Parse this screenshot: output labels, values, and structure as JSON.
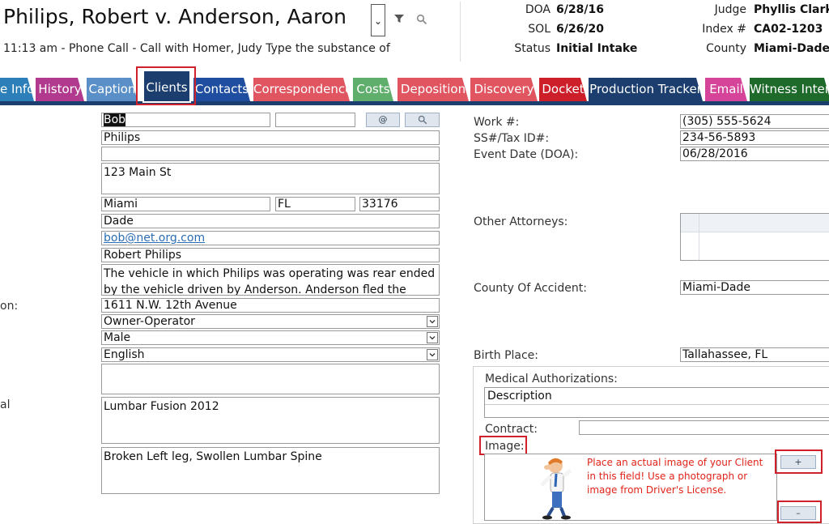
{
  "header": {
    "case_title": "Philips, Robert v. Anderson, Aaron",
    "last_activity": "11:13 am - Phone Call - Call with Homer, Judy  Type the substance of",
    "doa_label": "DOA",
    "doa_value": "6/28/16",
    "sol_label": "SOL",
    "sol_value": "6/26/20",
    "status_label": "Status",
    "status_value": "Initial Intake",
    "judge_label": "Judge",
    "judge_value": "Phyllis Clark",
    "index_label": "Index #",
    "index_value": "CA02-1203",
    "county_label": "County",
    "county_value": "Miami-Dade"
  },
  "tabs": [
    {
      "label": "e Info",
      "color": "#2c7fb8"
    },
    {
      "label": "History",
      "color": "#b23a8e"
    },
    {
      "label": "Caption",
      "color": "#5b8fc7"
    },
    {
      "label": "Clients",
      "color": "#1b3e6e",
      "active": true
    },
    {
      "label": "Contacts",
      "color": "#1f4ea1"
    },
    {
      "label": "Correspondence",
      "color": "#e05560"
    },
    {
      "label": "Costs",
      "color": "#5fae6b"
    },
    {
      "label": "Deposition",
      "color": "#e05560"
    },
    {
      "label": "Discovery",
      "color": "#e05560"
    },
    {
      "label": "Docket",
      "color": "#cc1f2a"
    },
    {
      "label": "Production Tracker",
      "color": "#1b3e6e"
    },
    {
      "label": "Email",
      "color": "#d6449a"
    },
    {
      "label": "Witness Interv",
      "color": "#1e6a2a"
    }
  ],
  "left_labels": {
    "on": "on:",
    "al": "al"
  },
  "form": {
    "first_name": "Bob",
    "middle_name": "",
    "at_button": "@",
    "search_button_icon": "search-icon",
    "last_name": "Philips",
    "suffix": "",
    "address": "123 Main St",
    "city": "Miami",
    "state": "FL",
    "zip": "33176",
    "county": "Dade",
    "email": "bob@net.org.com",
    "full_name": "Robert Philips",
    "description": "The vehicle in which Philips was operating was rear ended by the vehicle driven by Anderson.  Anderson fled the",
    "accident_location": "1611 N.W. 12th Avenue",
    "occupation": "Owner-Operator",
    "gender": "Male",
    "language": "English",
    "notes": "",
    "medical_history": "Lumbar Fusion 2012",
    "injuries": "Broken Left leg, Swollen Lumbar Spine"
  },
  "right": {
    "work_label": "Work #:",
    "work_value": "(305) 555-5624",
    "ss_label": "SS#/Tax ID#:",
    "ss_value": "234-56-5893",
    "event_label": "Event Date (DOA):",
    "event_value": "06/28/2016",
    "other_attorneys_label": "Other Attorneys:",
    "county_accident_label": "County Of Accident:",
    "county_accident_value": "Miami-Dade",
    "birth_place_label": "Birth Place:",
    "birth_place_value": "Tallahassee, FL",
    "med_auth_label": "Medical Authorizations:",
    "med_auth_header": "Description",
    "contract_label": "Contract:",
    "contract_value": "",
    "image_label": "Image:",
    "image_note": "Place an actual image of your Client in this field!  Use a photograph or image from Driver's License.",
    "add_image": "+",
    "remove_image": "–"
  }
}
